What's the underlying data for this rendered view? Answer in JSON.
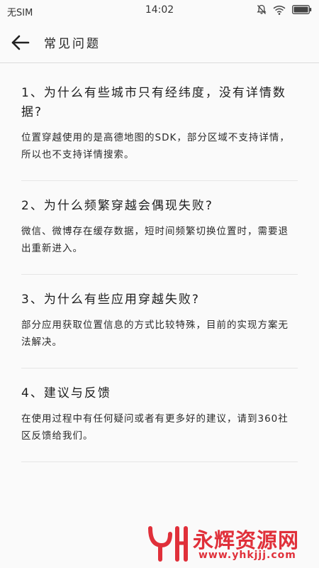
{
  "status_bar": {
    "carrier": "无SIM",
    "time": "14:02"
  },
  "app_bar": {
    "title": "常见问题"
  },
  "faqs": [
    {
      "question": "1、为什么有些城市只有经纬度，没有详情数据?",
      "answer": "位置穿越使用的是高德地图的SDK，部分区域不支持详情，所以也不支持详情搜索。"
    },
    {
      "question": "2、为什么频繁穿越会偶现失败?",
      "answer": "微信、微博存在缓存数据，短时间频繁切换位置时，需要退出重新进入。"
    },
    {
      "question": "3、为什么有些应用穿越失败?",
      "answer": "部分应用获取位置信息的方式比较特殊，目前的实现方案无法解决。"
    },
    {
      "question": "4、建议与反馈",
      "answer": "在使用过程中有任何疑问或者有更多好的建议，请到360社区反馈给我们。"
    }
  ],
  "watermark": {
    "name": "永辉资源网",
    "url": "www.yhkjjj.com",
    "color": "#e0303a"
  }
}
